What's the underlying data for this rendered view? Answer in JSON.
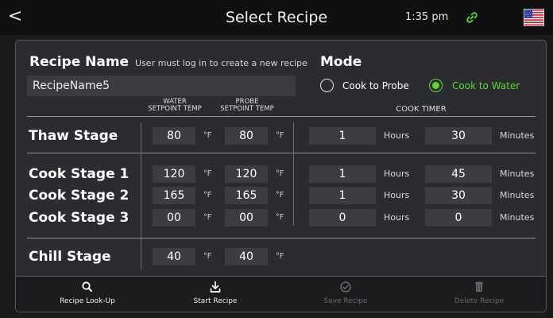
{
  "header": {
    "back_symbol": "<",
    "title": "Select Recipe",
    "time": "1:35 pm",
    "link_icon": "link-icon",
    "flag_icon": "us-flag-icon",
    "accent_color": "#5dd53a"
  },
  "recipe": {
    "name_label": "Recipe Name",
    "name_hint": "User must log in to create a new recipe",
    "name_value": "RecipeName5"
  },
  "mode": {
    "label": "Mode",
    "options": [
      {
        "label": "Cook to Probe",
        "selected": false
      },
      {
        "label": "Cook to Water",
        "selected": true
      }
    ]
  },
  "columns": {
    "water_line1": "WATER",
    "water_line2": "SETPOINT TEMP",
    "probe_line1": "PROBE",
    "probe_line2": "SETPOINT TEMP",
    "cook_timer": "COOK TIMER"
  },
  "units": {
    "temp": "°F",
    "hours": "Hours",
    "minutes": "Minutes"
  },
  "stages": [
    {
      "name": "Thaw Stage",
      "water": "80",
      "probe": "80",
      "hours": "1",
      "minutes": "30"
    },
    {
      "name": "Cook Stage 1",
      "water": "120",
      "probe": "120",
      "hours": "1",
      "minutes": "45"
    },
    {
      "name": "Cook Stage 2",
      "water": "165",
      "probe": "165",
      "hours": "1",
      "minutes": "30"
    },
    {
      "name": "Cook Stage 3",
      "water": "00",
      "probe": "00",
      "hours": "0",
      "minutes": "0"
    },
    {
      "name": "Chill Stage",
      "water": "40",
      "probe": "40"
    }
  ],
  "toolbar": {
    "lookup_label": "Recipe Look-Up",
    "start_label": "Start Recipe",
    "save_label": "Save Recipe",
    "delete_label": "Delete Recipe",
    "lookup_icon": "search-icon",
    "start_icon": "download-icon",
    "save_icon": "check-circle-icon",
    "delete_icon": "trash-icon",
    "save_enabled": false,
    "delete_enabled": false
  }
}
